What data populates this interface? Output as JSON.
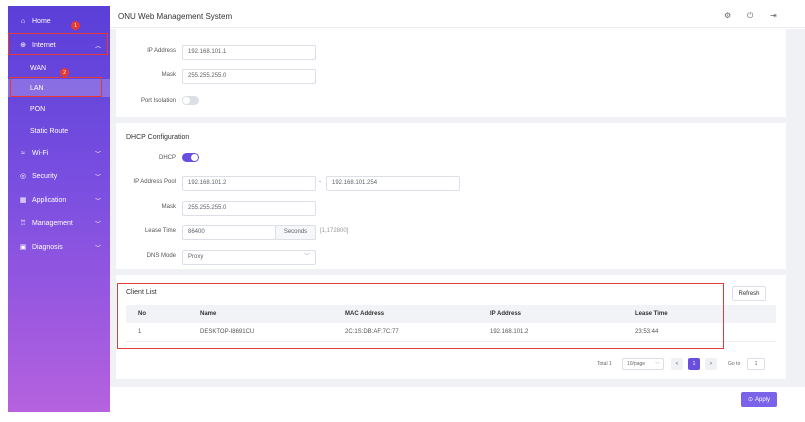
{
  "header": {
    "title": "ONU Web Management System"
  },
  "sidebar": {
    "items": [
      {
        "label": "Home",
        "icon": "home-icon"
      },
      {
        "label": "Internet",
        "icon": "globe-icon"
      },
      {
        "label": "Wi-Fi",
        "icon": "wifi-icon"
      },
      {
        "label": "Security",
        "icon": "shield-icon"
      },
      {
        "label": "Application",
        "icon": "grid-icon"
      },
      {
        "label": "Management",
        "icon": "management-icon"
      },
      {
        "label": "Diagnosis",
        "icon": "toolbox-icon"
      }
    ],
    "internet_sub": [
      "WAN",
      "LAN",
      "PON",
      "Static Route"
    ],
    "badges": [
      "1",
      "2"
    ]
  },
  "lan": {
    "ip_label": "IP Address",
    "ip_value": "192.168.101.1",
    "mask_label": "Mask",
    "mask_value": "255.255.255.0",
    "port_isolation_label": "Port Isolation"
  },
  "dhcp": {
    "title": "DHCP Configuration",
    "dhcp_label": "DHCP",
    "pool_label": "IP Address Pool",
    "pool_start": "192.168.101.2",
    "pool_sep": "-",
    "pool_end": "192.168.101.254",
    "mask_label": "Mask",
    "mask_value": "255.255.255.0",
    "lease_label": "Lease Time",
    "lease_value": "86400",
    "lease_unit": "Seconds",
    "lease_range": "[1,172800]",
    "dns_label": "DNS Mode",
    "dns_value": "Proxy"
  },
  "client_list": {
    "title": "Client List",
    "refresh_label": "Refresh",
    "columns": [
      "No",
      "Name",
      "MAC Address",
      "IP Address",
      "Lease Time"
    ],
    "rows": [
      [
        "1",
        "DESKTOP-I8691CU",
        "2C:1S:DB:AF:7C:77",
        "192.168.101.2",
        "23:53:44"
      ]
    ]
  },
  "pagination": {
    "total": "Total 1",
    "page_size": "10/page",
    "prev": "<",
    "current": "1",
    "next": ">",
    "goto_label": "Go to",
    "goto_value": "1"
  },
  "apply_label": "Apply",
  "colors": {
    "accent": "#6a4ee0",
    "highlight": "#e53935"
  }
}
